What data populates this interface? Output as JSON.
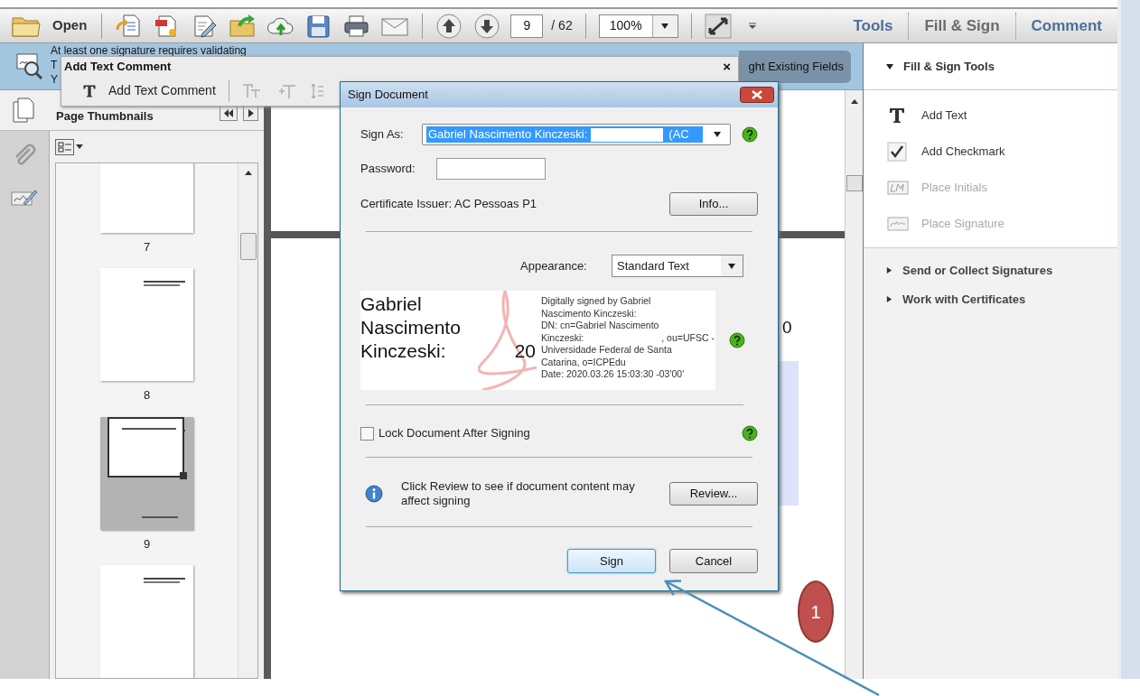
{
  "toolbar": {
    "open_label": "Open",
    "page_current": "9",
    "page_total": "/ 62",
    "zoom": "100%",
    "tabs": [
      {
        "label": "Tools",
        "selected": false
      },
      {
        "label": "Fill & Sign",
        "selected": true
      },
      {
        "label": "Comment",
        "selected": false
      }
    ]
  },
  "notice": {
    "lines": [
      "At least one signature requires validating",
      "T",
      "Y"
    ],
    "button": "ght Existing Fields"
  },
  "comment_toolbar": {
    "title": "Add Text Comment",
    "close": "×",
    "tool": "Add Text Comment"
  },
  "navigation": {
    "title": "Page Thumbnails",
    "thumbnails": [
      {
        "label": "7",
        "selected": false
      },
      {
        "label": "8",
        "selected": false
      },
      {
        "label": "9",
        "selected": true
      },
      {
        "selected": false
      }
    ]
  },
  "document": {
    "text": "0"
  },
  "dialog": {
    "title": "Sign Document",
    "sign_as_label": "Sign As:",
    "sign_as_value": [
      "Gabriel Nascimento Kinczeski:",
      "(AC"
    ],
    "password_label": "Password:",
    "issuer": "Certificate Issuer: AC Pessoas P1",
    "info_button": "Info...",
    "appearance_label": "Appearance:",
    "appearance_value": "Standard Text",
    "preview": {
      "name_lines": [
        "Gabriel",
        "Nascimento",
        "Kinczeski:"
      ],
      "number": "20",
      "details": [
        [
          "Digitally signed by Gabriel"
        ],
        [
          "Nascimento Kinczeski:"
        ],
        [
          "DN: cn=Gabriel Nascimento"
        ],
        [
          "Kinczeski:",
          ", ou=UFSC -"
        ],
        [
          "Universidade Federal de Santa"
        ],
        [
          "Catarina, o=ICPEdu"
        ],
        [
          "Date: 2020.03.26 15:03:30 -03'00'"
        ]
      ]
    },
    "lock": {
      "label": "Lock Document After Signing",
      "checked": false
    },
    "review_note": "Click Review to see if document content may affect signing",
    "review_button": "Review...",
    "buttons": [
      {
        "label": "Sign",
        "default": true
      },
      {
        "label": "Cancel",
        "default": false
      }
    ]
  },
  "side_panel": {
    "section": "Fill & Sign Tools",
    "expanded": true,
    "tools": [
      {
        "label": "Add Text",
        "kind": "text",
        "disabled": false
      },
      {
        "label": "Add Checkmark",
        "kind": "check",
        "disabled": false
      },
      {
        "label": "Place Initials",
        "kind": "initials",
        "disabled": true
      },
      {
        "label": "Place Signature",
        "kind": "signature",
        "disabled": true
      }
    ],
    "groups": [
      {
        "label": "Send or Collect Signatures",
        "expanded": false
      },
      {
        "label": "Work with Certificates",
        "expanded": false
      }
    ]
  },
  "callout": {
    "label": "1"
  }
}
